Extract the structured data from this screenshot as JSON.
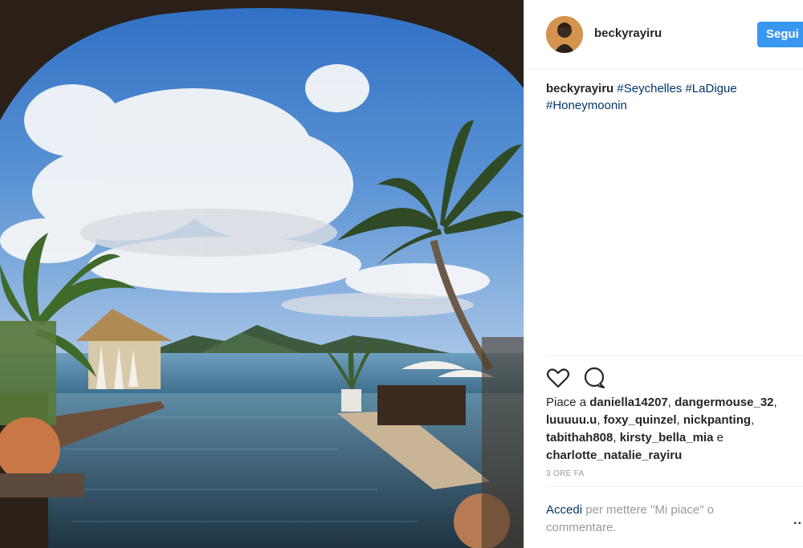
{
  "post": {
    "username": "beckyrayiru",
    "follow_label": "Segui",
    "caption": {
      "username": "beckyrayiru",
      "hashtags": [
        "#Seychelles",
        "#LaDigue",
        "#Honeymoonin"
      ]
    },
    "icons": {
      "like": "heart-icon",
      "comment": "comment-bubble-icon",
      "more": "more-options-icon"
    },
    "likes": {
      "prefix": "Piace a",
      "users": [
        "daniella14207",
        "dangermouse_32",
        "luuuuu.u",
        "foxy_quinzel",
        "nickpanting",
        "tabithah808",
        "kirsty_bella_mia"
      ],
      "conjunction": "e",
      "last_user": "charlotte_natalie_rayiru"
    },
    "timestamp": "3 ORE FA",
    "login_prompt": {
      "link": "Accedi",
      "text": "per mettere \"Mi piace\" o commentare."
    },
    "more_label": "..."
  },
  "colors": {
    "follow_button": "#3897f0",
    "hashtag": "#003569",
    "muted": "#999999",
    "text": "#262626"
  }
}
